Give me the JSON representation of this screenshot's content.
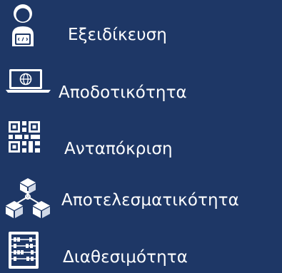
{
  "features": [
    {
      "label": "Εξειδίκευση",
      "icon": "developer-user-icon"
    },
    {
      "label": "Αποδοτικότητα",
      "icon": "laptop-globe-icon"
    },
    {
      "label": "Ανταπόκριση",
      "icon": "qr-code-icon"
    },
    {
      "label": "Αποτελεσματικότητα",
      "icon": "cubes-network-icon"
    },
    {
      "label": "Διαθεσιμότητα",
      "icon": "abacus-icon"
    }
  ],
  "colors": {
    "background": "#1e3766",
    "foreground": "#ffffff"
  }
}
